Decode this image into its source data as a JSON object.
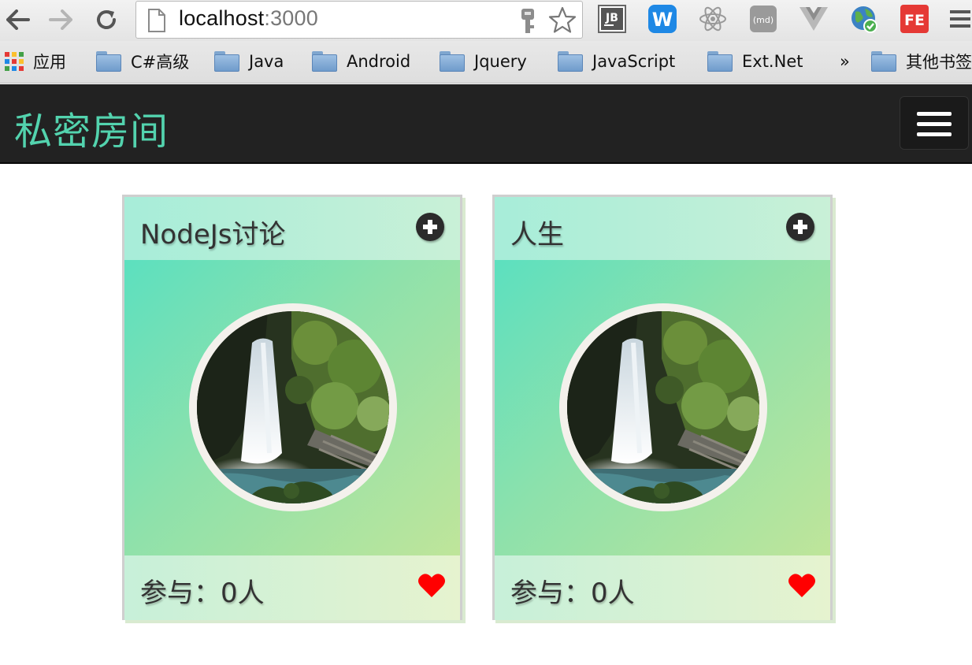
{
  "browser": {
    "url_host": "localhost",
    "url_port": ":3000",
    "extensions": [
      "jetbrains-icon",
      "w-extension-icon",
      "react-icon",
      "md-icon",
      "vue-icon",
      "globe-icon",
      "fe-icon"
    ],
    "extension_labels": {
      "jb": "JB",
      "w": "W",
      "md": "(md)",
      "fe": "FE"
    }
  },
  "bookmarks": {
    "apps": "应用",
    "items": [
      "C#高级",
      "Java",
      "Android",
      "Jquery",
      "JavaScript",
      "Ext.Net"
    ],
    "overflow": "»",
    "other": "其他书签"
  },
  "navbar": {
    "brand": "私密房间",
    "brand_color": "#53d3ae"
  },
  "rooms": [
    {
      "title": "NodeJs讨论",
      "participants": "参与：0人"
    },
    {
      "title": "人生",
      "participants": "参与：0人"
    }
  ],
  "colors": {
    "heart": "#ff0000",
    "navbar_bg": "#222222"
  }
}
